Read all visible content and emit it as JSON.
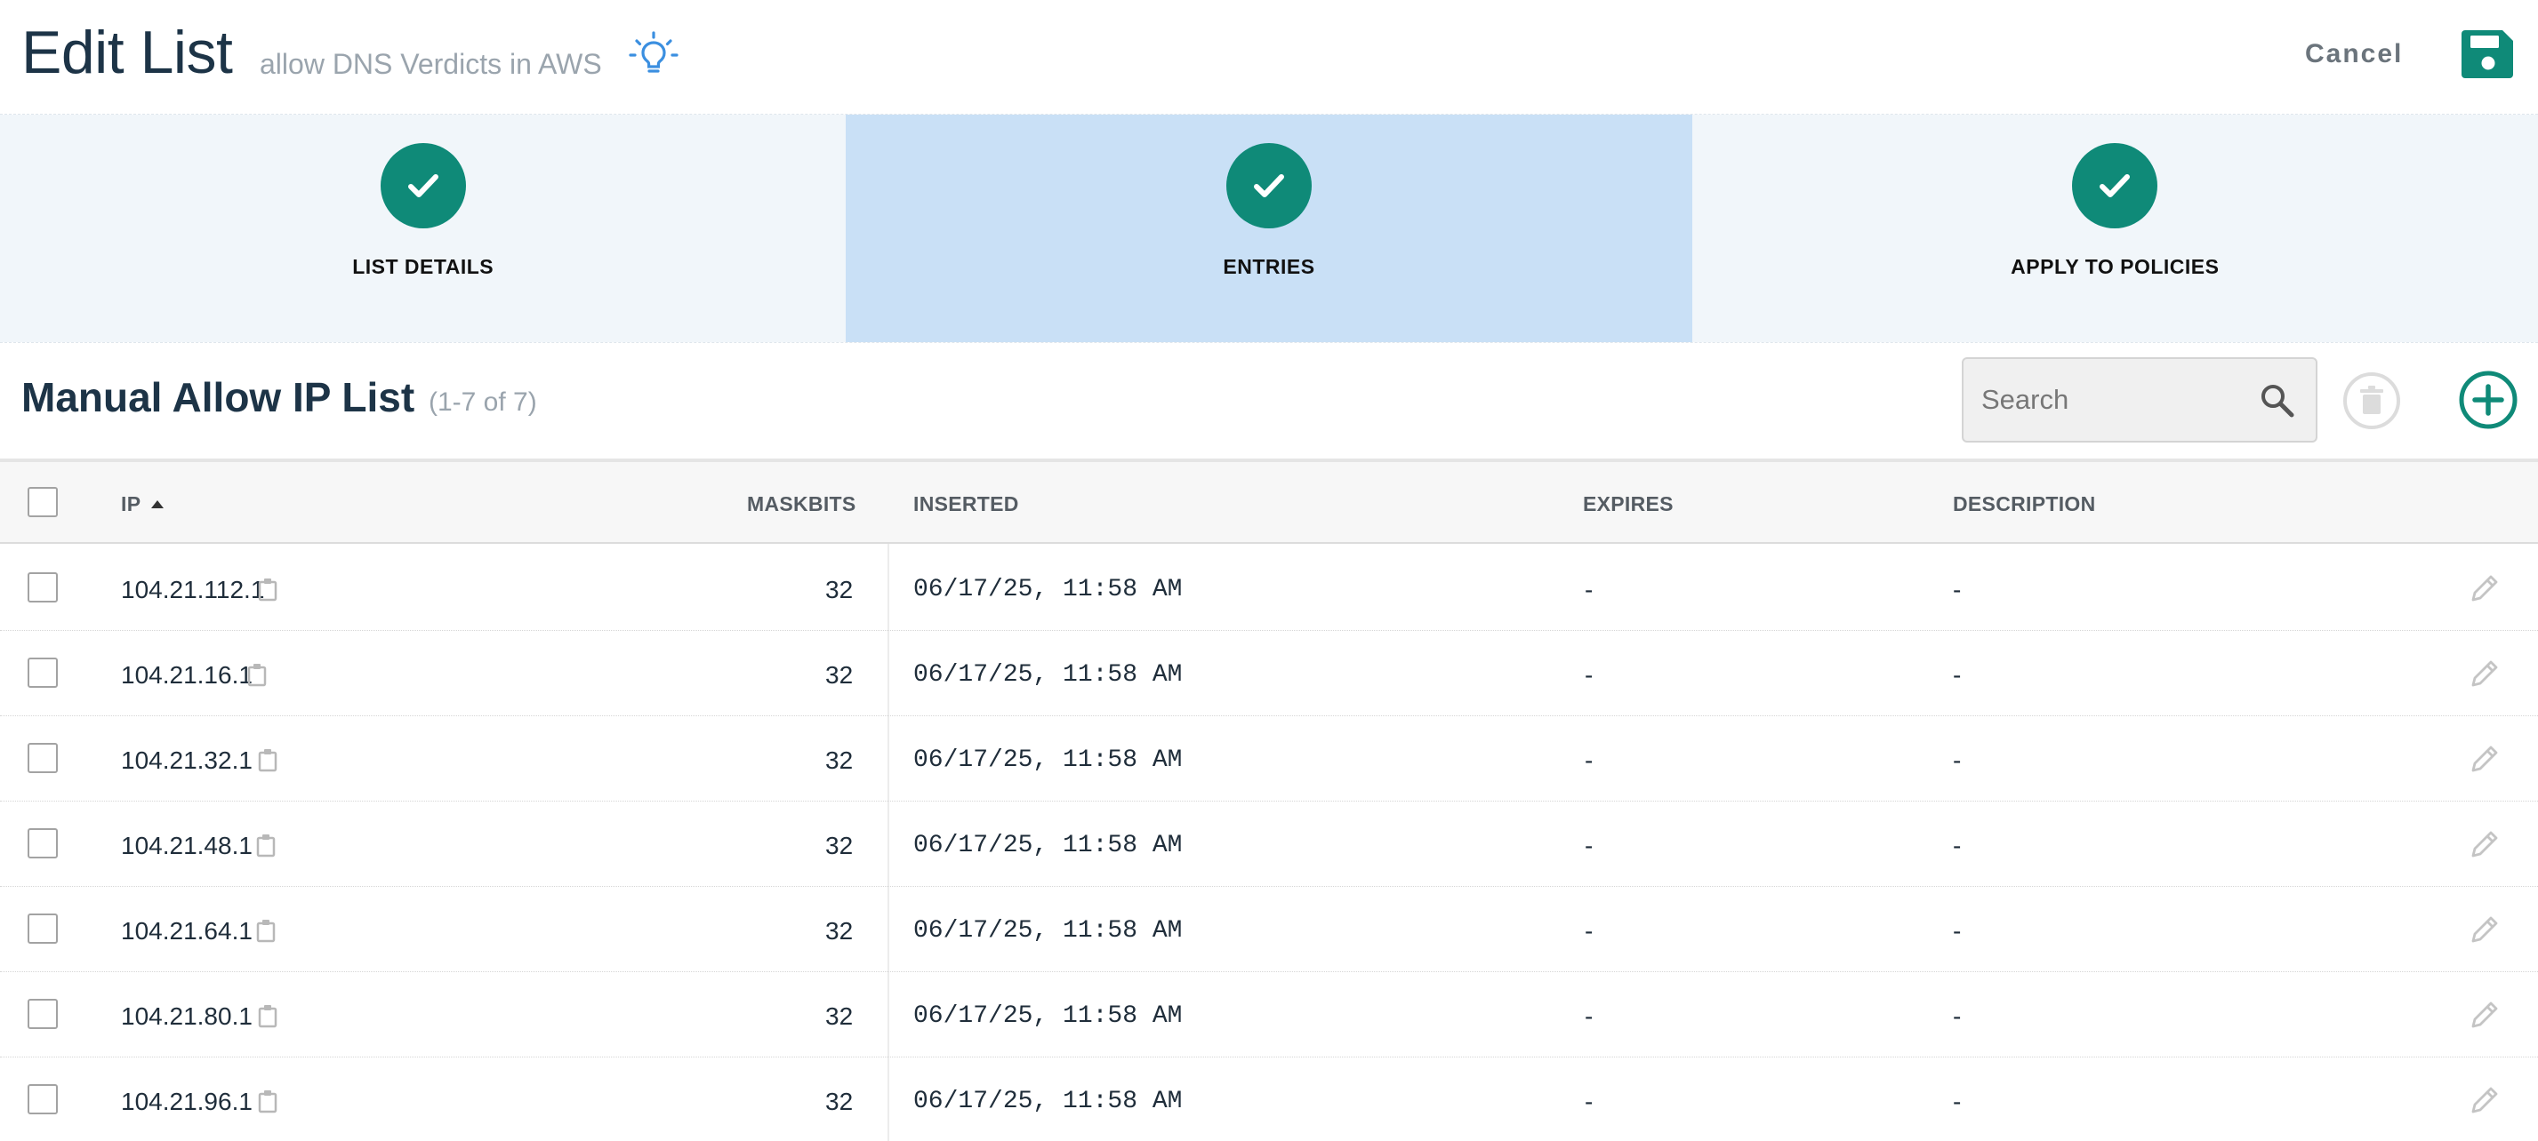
{
  "header": {
    "title": "Edit List",
    "subtitle": "allow DNS Verdicts in AWS",
    "cancel_label": "Cancel"
  },
  "steps": [
    {
      "label": "LIST DETAILS",
      "active": false
    },
    {
      "label": "ENTRIES",
      "active": true
    },
    {
      "label": "APPLY TO POLICIES",
      "active": false
    }
  ],
  "list": {
    "title": "Manual Allow IP List",
    "count": "(1-7 of 7)",
    "search_placeholder": "Search"
  },
  "table": {
    "columns": {
      "ip": "IP",
      "maskbits": "MASKBITS",
      "inserted": "INSERTED",
      "expires": "EXPIRES",
      "description": "DESCRIPTION"
    },
    "rows": [
      {
        "ip": "104.21.112.1",
        "maskbits": "32",
        "inserted": "06/17/25, 11:58 AM",
        "expires": "-",
        "description": "-"
      },
      {
        "ip": "104.21.16.1",
        "maskbits": "32",
        "inserted": "06/17/25, 11:58 AM",
        "expires": "-",
        "description": "-"
      },
      {
        "ip": "104.21.32.1",
        "maskbits": "32",
        "inserted": "06/17/25, 11:58 AM",
        "expires": "-",
        "description": "-"
      },
      {
        "ip": "104.21.48.1",
        "maskbits": "32",
        "inserted": "06/17/25, 11:58 AM",
        "expires": "-",
        "description": "-"
      },
      {
        "ip": "104.21.64.1",
        "maskbits": "32",
        "inserted": "06/17/25, 11:58 AM",
        "expires": "-",
        "description": "-"
      },
      {
        "ip": "104.21.80.1",
        "maskbits": "32",
        "inserted": "06/17/25, 11:58 AM",
        "expires": "-",
        "description": "-"
      },
      {
        "ip": "104.21.96.1",
        "maskbits": "32",
        "inserted": "06/17/25, 11:58 AM",
        "expires": "-",
        "description": "-"
      }
    ]
  },
  "icons": {
    "hint": "lightbulb-icon",
    "save": "floppy-disk-icon",
    "step_done": "check-icon",
    "search": "search-icon",
    "delete": "trash-icon",
    "add": "plus-circle-icon",
    "copy": "clipboard-icon",
    "edit": "pencil-icon"
  },
  "colors": {
    "accent": "#0f8a78",
    "active_step": "#c9e0f6",
    "step_bg": "#f1f6fa",
    "hint_icon": "#3b8fe0"
  }
}
